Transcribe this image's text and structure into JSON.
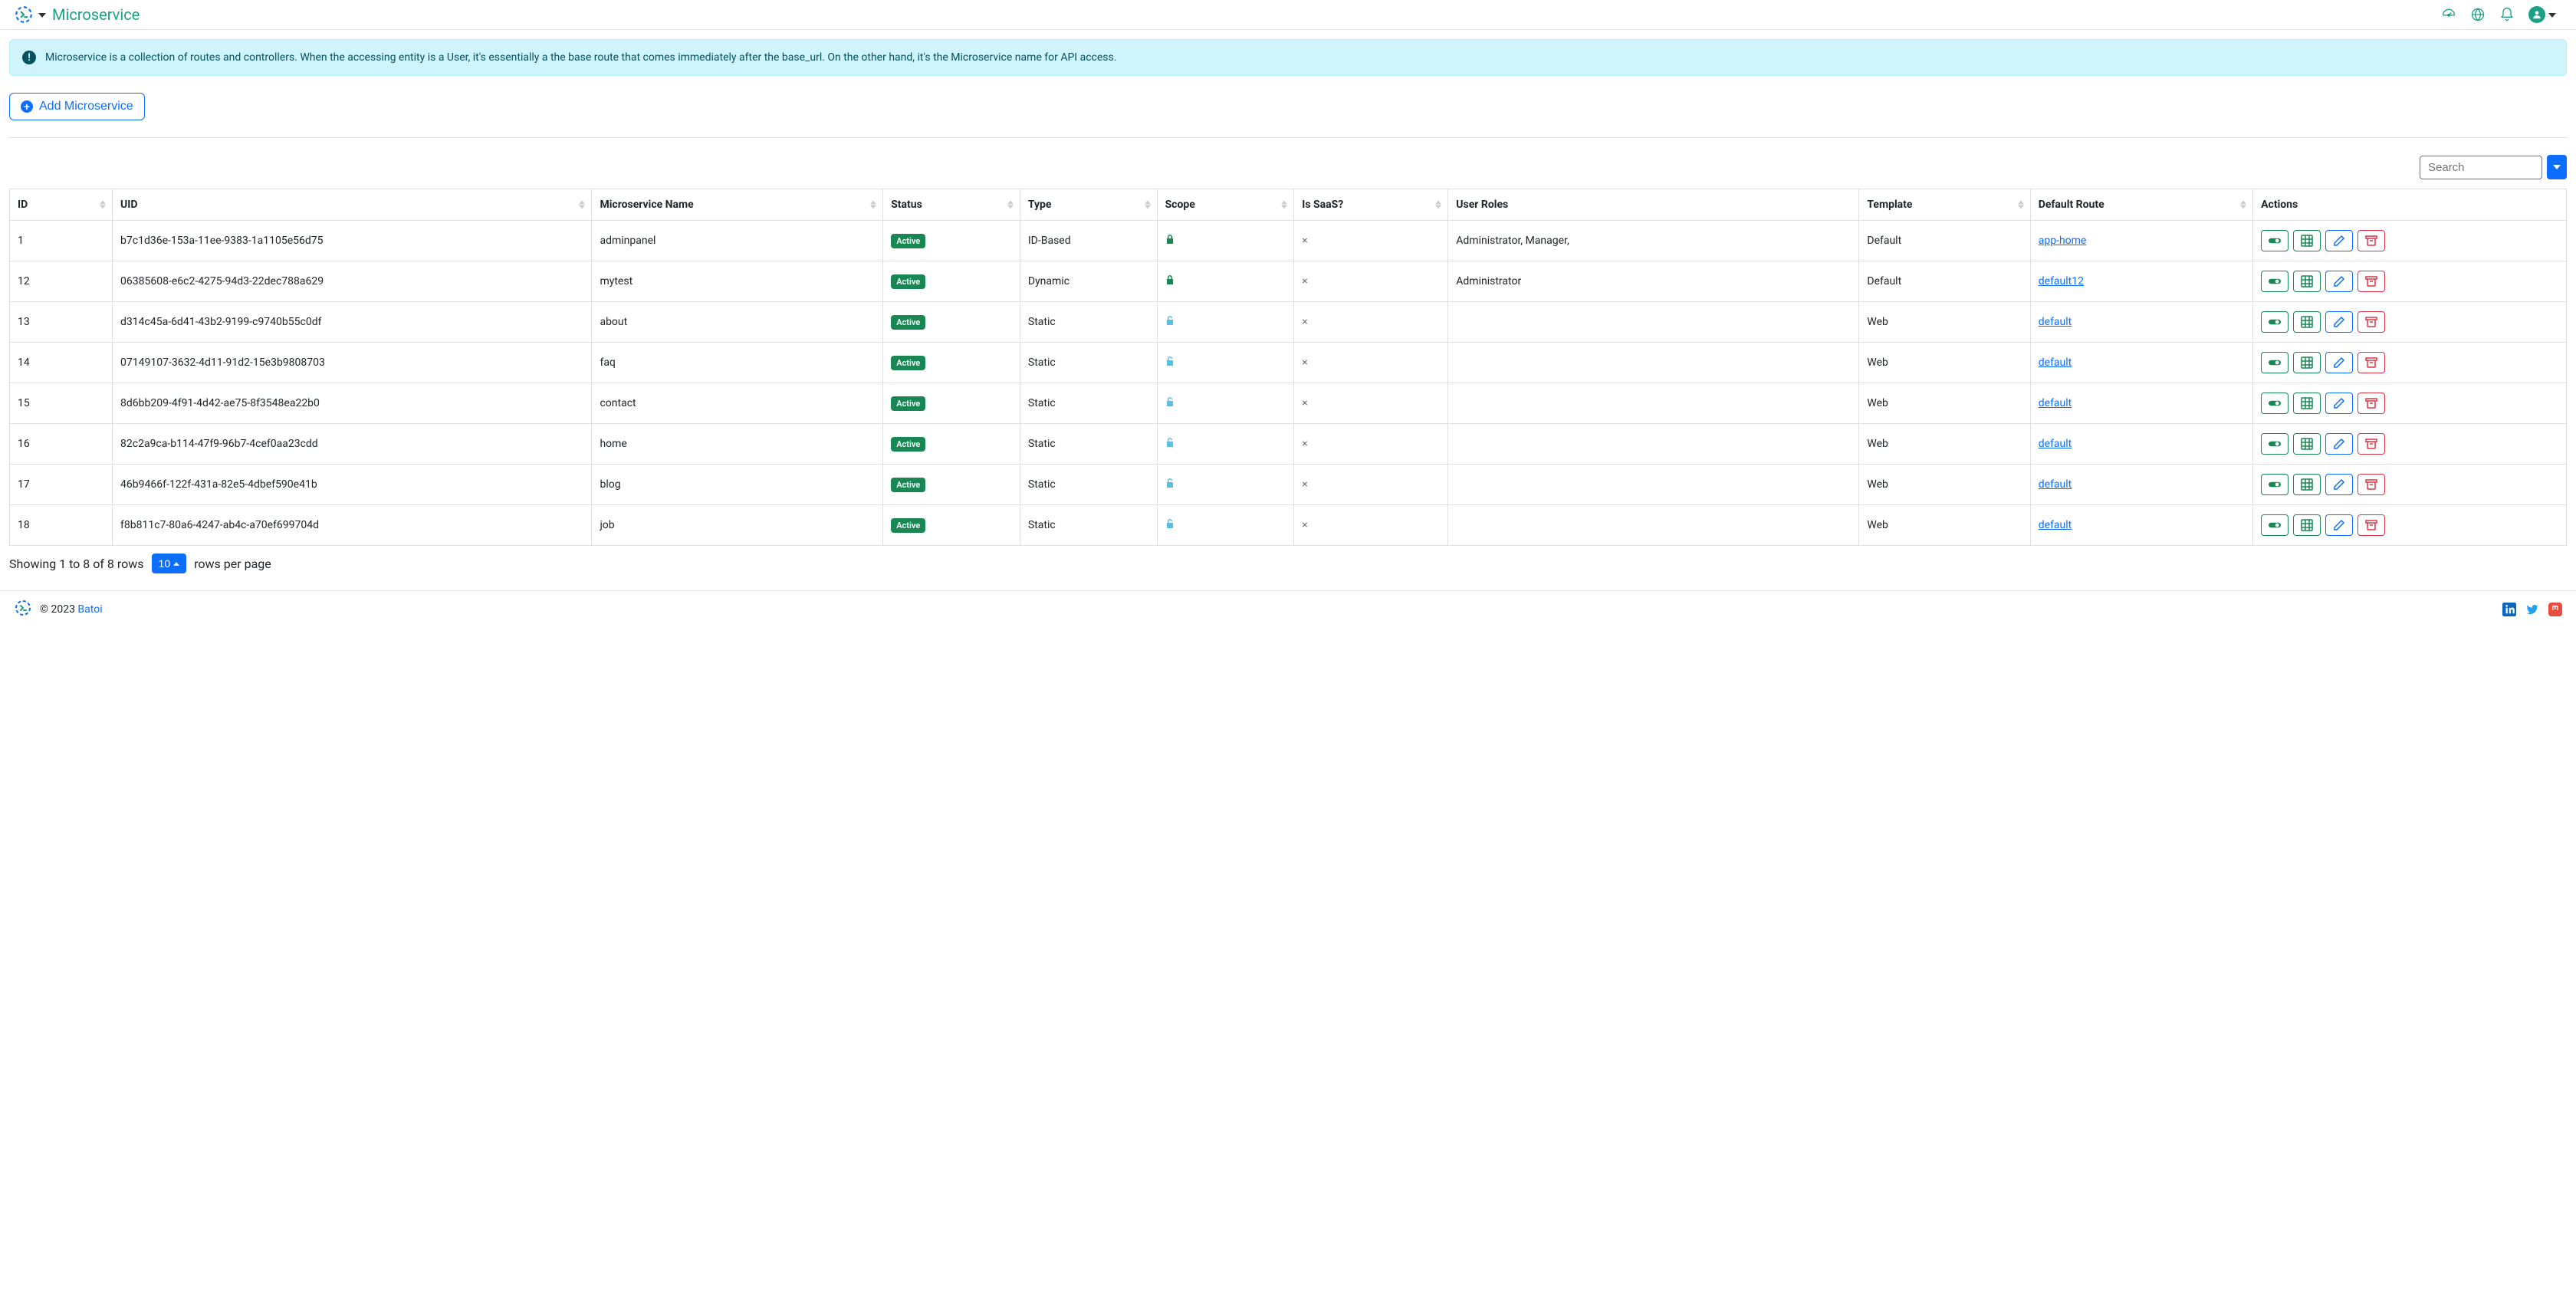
{
  "header": {
    "title": "Microservice"
  },
  "alert": {
    "text": "Microservice is a collection of routes and controllers. When the accessing entity is a User, it's essentially a the base route that comes immediately after the base_url. On the other hand, it's the Microservice name for API access."
  },
  "add_button": {
    "label": "Add Microservice"
  },
  "search": {
    "placeholder": "Search"
  },
  "columns": {
    "id": "ID",
    "uid": "UID",
    "name": "Microservice Name",
    "status": "Status",
    "type": "Type",
    "scope": "Scope",
    "saas": "Is SaaS?",
    "roles": "User Roles",
    "template": "Template",
    "route": "Default Route",
    "actions": "Actions"
  },
  "status_label": "Active",
  "rows": [
    {
      "id": "1",
      "uid": "b7c1d36e-153a-11ee-9383-1a1105e56d75",
      "name": "adminpanel",
      "type": "ID-Based",
      "scope": "locked",
      "saas": "x",
      "roles": "Administrator, Manager,",
      "template": "Default",
      "route": "app-home"
    },
    {
      "id": "12",
      "uid": "06385608-e6c2-4275-94d3-22dec788a629",
      "name": "mytest",
      "type": "Dynamic",
      "scope": "locked",
      "saas": "x",
      "roles": "Administrator",
      "template": "Default",
      "route": "default12"
    },
    {
      "id": "13",
      "uid": "d314c45a-6d41-43b2-9199-c9740b55c0df",
      "name": "about",
      "type": "Static",
      "scope": "unlocked",
      "saas": "x",
      "roles": "",
      "template": "Web",
      "route": "default"
    },
    {
      "id": "14",
      "uid": "07149107-3632-4d11-91d2-15e3b9808703",
      "name": "faq",
      "type": "Static",
      "scope": "unlocked",
      "saas": "x",
      "roles": "",
      "template": "Web",
      "route": "default"
    },
    {
      "id": "15",
      "uid": "8d6bb209-4f91-4d42-ae75-8f3548ea22b0",
      "name": "contact",
      "type": "Static",
      "scope": "unlocked",
      "saas": "x",
      "roles": "",
      "template": "Web",
      "route": "default"
    },
    {
      "id": "16",
      "uid": "82c2a9ca-b114-47f9-96b7-4cef0aa23cdd",
      "name": "home",
      "type": "Static",
      "scope": "unlocked",
      "saas": "x",
      "roles": "",
      "template": "Web",
      "route": "default"
    },
    {
      "id": "17",
      "uid": "46b9466f-122f-431a-82e5-4dbef590e41b",
      "name": "blog",
      "type": "Static",
      "scope": "unlocked",
      "saas": "x",
      "roles": "",
      "template": "Web",
      "route": "default"
    },
    {
      "id": "18",
      "uid": "f8b811c7-80a6-4247-ab4c-a70ef699704d",
      "name": "job",
      "type": "Static",
      "scope": "unlocked",
      "saas": "x",
      "roles": "",
      "template": "Web",
      "route": "default"
    }
  ],
  "pagination": {
    "info_pre": "Showing 1 to 8 of 8 rows",
    "page_size": "10",
    "info_post": "rows per page"
  },
  "footer": {
    "copyright": "© 2023 ",
    "brand": "Batoi"
  }
}
